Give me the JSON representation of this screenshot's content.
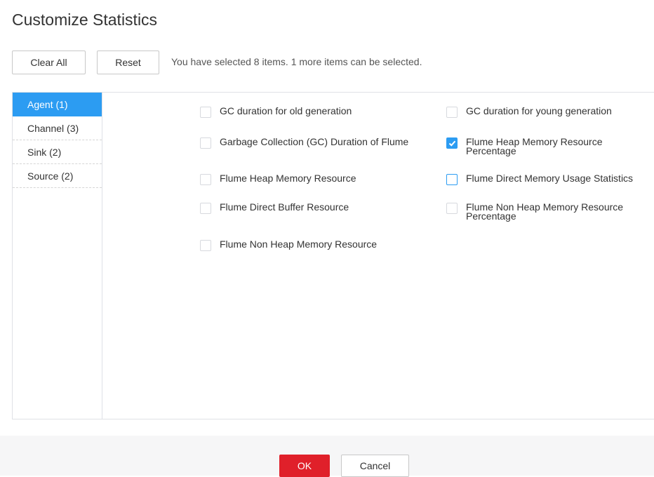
{
  "dialog": {
    "title": "Customize Statistics"
  },
  "toolbar": {
    "clear_all_label": "Clear All",
    "reset_label": "Reset",
    "selection_hint": "You have selected 8 items. 1 more items can be selected."
  },
  "sidebar": {
    "items": [
      {
        "label": "Agent (1)",
        "active": true
      },
      {
        "label": "Channel (3)",
        "active": false
      },
      {
        "label": "Sink (2)",
        "active": false
      },
      {
        "label": "Source (2)",
        "active": false
      }
    ]
  },
  "options": [
    {
      "label": "GC duration for old generation",
      "checked": false
    },
    {
      "label": "GC duration for young generation",
      "checked": false
    },
    {
      "label": "Garbage Collection (GC) Duration of Flume",
      "checked": false
    },
    {
      "label": "Flume Heap Memory Resource Percentage",
      "checked": true
    },
    {
      "label": "Flume Heap Memory Resource",
      "checked": false
    },
    {
      "label": "Flume Direct Memory Usage Statistics",
      "checked": false,
      "focused": true
    },
    {
      "label": "Flume Direct Buffer Resource",
      "checked": false
    },
    {
      "label": "Flume Non Heap Memory Resource Percentage",
      "checked": false
    },
    {
      "label": "Flume Non Heap Memory Resource",
      "checked": false
    }
  ],
  "footer": {
    "ok_label": "OK",
    "cancel_label": "Cancel"
  },
  "colors": {
    "accent": "#2c9cf2",
    "primary_button": "#e0202a"
  }
}
